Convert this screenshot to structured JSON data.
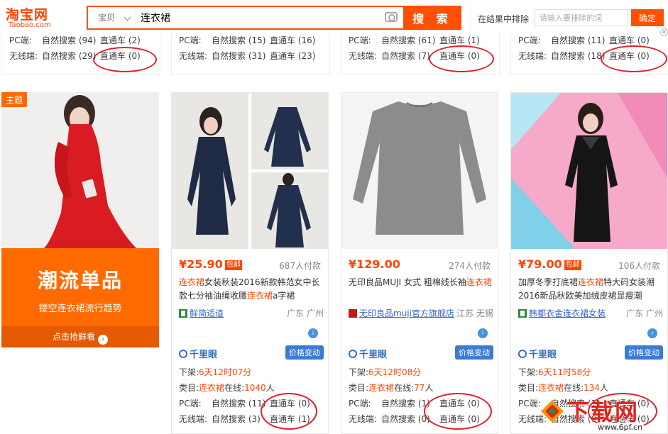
{
  "header": {
    "logo_cn": "淘宝网",
    "logo_en": "Taobao.com",
    "scope_label": "宝贝",
    "search_value": "连衣裙",
    "search_button": "搜 索",
    "exclude_label": "在结果中排除",
    "exclude_placeholder": "请输入要排除的词",
    "exclude_button": "确定"
  },
  "top_row": [
    {
      "pc_label": "PC端:",
      "pc_search": "自然搜索 (94)",
      "pc_ztc": "直通车 (2)",
      "wx_label": "无线端:",
      "wx_search": "自然搜索 (29)",
      "wx_ztc": "直通车 (0)"
    },
    {
      "pc_label": "PC端:",
      "pc_search": "自然搜索 (15)",
      "pc_ztc": "直通车 (16)",
      "wx_label": "无线端:",
      "wx_search": "自然搜索 (31)",
      "wx_ztc": "直通车 (23)"
    },
    {
      "pc_label": "PC端:",
      "pc_search": "自然搜索 (61)",
      "pc_ztc": "直通车 (1)",
      "wx_label": "无线端:",
      "wx_search": "自然搜索 (7)",
      "wx_ztc": "直通车 (0)"
    },
    {
      "pc_label": "PC端:",
      "pc_search": "自然搜索 (11)",
      "pc_ztc": "直通车 (0)",
      "wx_label": "无线端:",
      "wx_search": "自然搜索 (18)",
      "wx_ztc": "直通车 (0)"
    }
  ],
  "theme": {
    "tag": "主题",
    "big": "潮流单品",
    "sub": "镂空连衣裙流行趋势",
    "cta": "点击抢鲜看"
  },
  "products": [
    {
      "price": "¥25.90",
      "baoyou": "包邮",
      "paid": "687人付款",
      "title_a": "连衣裙",
      "title_b": "女装秋装2016新款韩范女中长款七分袖油绳收腰",
      "title_c": "连衣裙",
      "title_d": "a字裙",
      "shop": "鲜简适道",
      "loc": "广东 广州",
      "qlj": "千里眼",
      "price_change": "价格变动",
      "shelf_label": "下架:",
      "shelf_value": "6天12时07分",
      "cat_label": "类目:",
      "cat_value": "连衣裙",
      "online_label": "在线:",
      "online_value": "1040",
      "online_unit": "人",
      "pc_label": "PC端:",
      "pc_search": "自然搜索 (11)",
      "pc_ztc": "直通车 (0)",
      "wx_label": "无线端:",
      "wx_search": "自然搜索 (3)",
      "wx_ztc": "直通车 (1)"
    },
    {
      "price": "¥129.00",
      "baoyou": "",
      "paid": "274人付款",
      "title_a": "无印良品MUJI 女式 粗棉线长袖",
      "title_b": "",
      "title_c": "连衣裙",
      "title_d": "",
      "shop": "无印良品muji官方旗舰店",
      "loc": "江苏 无锡",
      "qlj": "千里眼",
      "price_change": "价格变动",
      "shelf_label": "下架:",
      "shelf_value": "6天12时08分",
      "cat_label": "类目:",
      "cat_value": "连衣裙",
      "online_label": "在线:",
      "online_value": "77",
      "online_unit": "人",
      "pc_label": "PC端:",
      "pc_search": "自然搜索 (1)",
      "pc_ztc": "直通车 (0)",
      "wx_label": "无线端:",
      "wx_search": "自然搜索 (0)",
      "wx_ztc": "直通车 (0)"
    },
    {
      "price": "¥79.00",
      "baoyou": "包邮",
      "paid": "106人付款",
      "title_a": "加厚冬季打底裙",
      "title_b": "",
      "title_c": "连衣裙",
      "title_d": "特大码女装潮2016新品秋欧美加绒皮裙显瘦潮",
      "shop": "韩都衣舍连衣裙女装",
      "loc": "广东 广州",
      "qlj": "千里眼",
      "price_change": "价格变动",
      "shelf_label": "下架:",
      "shelf_value": "6天11时58分",
      "cat_label": "类目:",
      "cat_value": "连衣裙",
      "online_label": "在线:",
      "online_value": "134",
      "online_unit": "人",
      "pc_label": "PC端:",
      "pc_search": "自然搜索 (1)",
      "pc_ztc": "直通车 (0)",
      "wx_label": "无线端:",
      "wx_search": "自然搜索 (0)",
      "wx_ztc": "直通车 (0)"
    }
  ],
  "watermark": {
    "text": "下载网",
    "url": "www.6pf.cn"
  },
  "colors": {
    "accent": "#ff5000",
    "price": "#ff4400",
    "annotation_circle": "#e0202e"
  }
}
